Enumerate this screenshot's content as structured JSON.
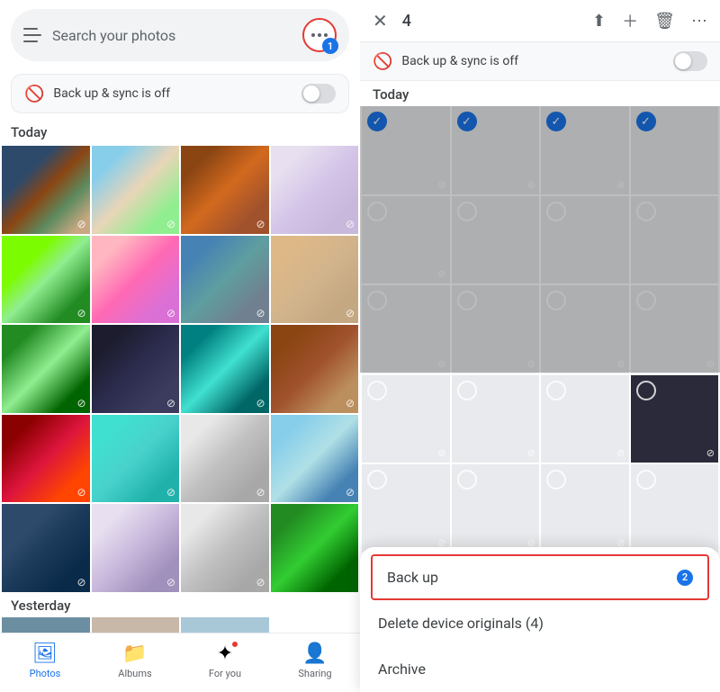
{
  "left": {
    "search_placeholder": "Search your photos",
    "sync_label": "Back up & sync is off",
    "today_label": "Today",
    "yesterday_label": "Yesterday",
    "more_badge": "1",
    "bottom_nav": [
      {
        "id": "photos",
        "label": "Photos",
        "icon": "🖼",
        "active": true
      },
      {
        "id": "albums",
        "label": "Albums",
        "icon": "📁",
        "active": false
      },
      {
        "id": "foryou",
        "label": "For you",
        "icon": "✨",
        "active": false,
        "badge": true
      },
      {
        "id": "sharing",
        "label": "Sharing",
        "icon": "👤",
        "active": false
      }
    ],
    "photos": [
      {
        "color": "c1"
      },
      {
        "color": "c2"
      },
      {
        "color": "c3"
      },
      {
        "color": "c4"
      },
      {
        "color": "c5"
      },
      {
        "color": "c6"
      },
      {
        "color": "c7"
      },
      {
        "color": "c8"
      },
      {
        "color": "c9"
      },
      {
        "color": "c10"
      },
      {
        "color": "c11"
      },
      {
        "color": "c12"
      },
      {
        "color": "c13"
      },
      {
        "color": "c14"
      },
      {
        "color": "c15"
      },
      {
        "color": "c16"
      },
      {
        "color": "c17"
      },
      {
        "color": "c18"
      },
      {
        "color": "c15"
      },
      {
        "color": "c19"
      }
    ]
  },
  "right": {
    "count": "4",
    "sync_label": "Back up & sync is off",
    "today_label": "Today",
    "bottom_sheet": {
      "backup_label": "Back up",
      "delete_label": "Delete device originals (4)",
      "archive_label": "Archive",
      "badge": "2"
    },
    "photos_row1": [
      {
        "color": "c2",
        "selected": true
      },
      {
        "color": "c3",
        "selected": true
      },
      {
        "color": "c4",
        "selected": true
      },
      {
        "color": "c5",
        "selected": true
      }
    ],
    "photos_row2": [
      {
        "color": "c6",
        "selected": false
      },
      {
        "color": "c7",
        "selected": false
      },
      {
        "color": "c8",
        "selected": false
      },
      {
        "color": "c9",
        "selected": false
      }
    ],
    "photos_row3": [
      {
        "color": "c11",
        "selected": false
      },
      {
        "color": "c12",
        "selected": false
      },
      {
        "color": "c8",
        "selected": false
      },
      {
        "color": "c10",
        "selected": false
      }
    ],
    "photos_row4": [
      {
        "color": "c13",
        "selected": false
      },
      {
        "color": "c14",
        "selected": false
      },
      {
        "color": "c15",
        "selected": false
      },
      {
        "color": "c16",
        "selected": false
      }
    ],
    "photos_row5": [
      {
        "color": "c17",
        "selected": false
      },
      {
        "color": "c18",
        "selected": false
      },
      {
        "color": "c15",
        "selected": false
      },
      {
        "color": "c19",
        "selected": false
      }
    ]
  }
}
